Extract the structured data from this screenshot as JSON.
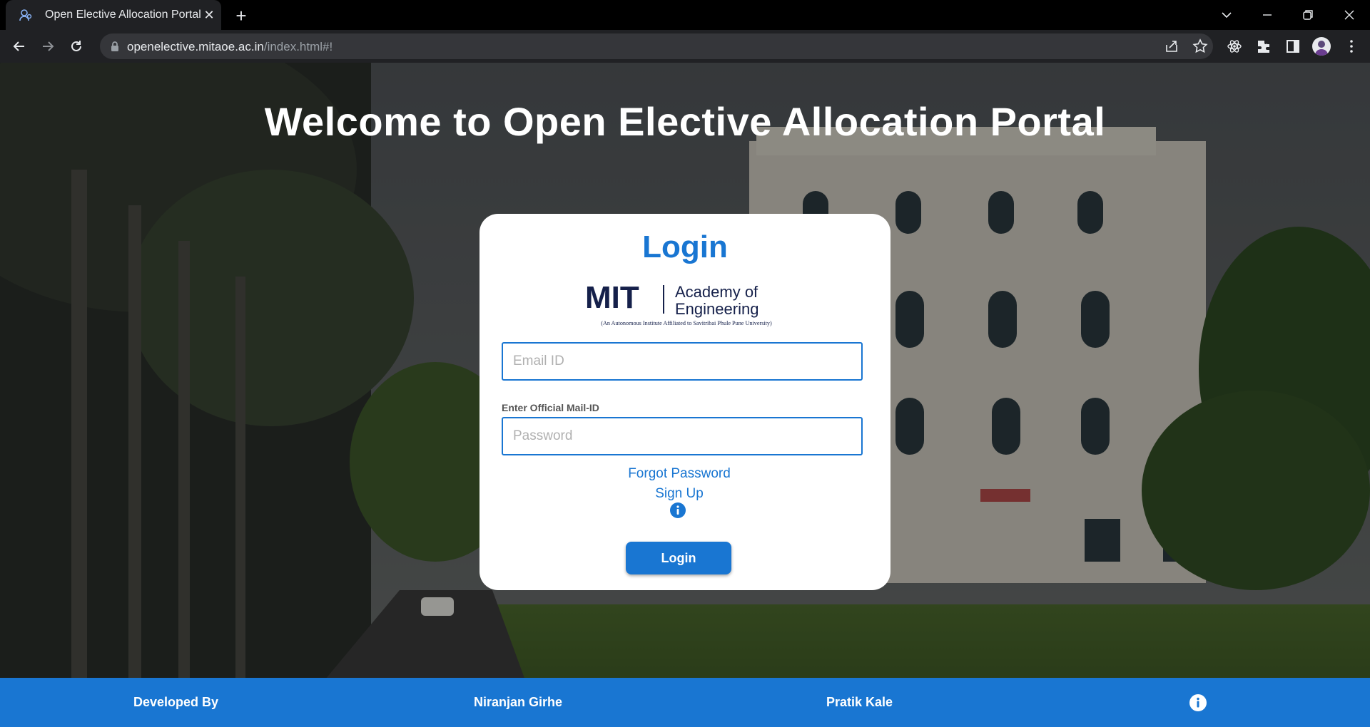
{
  "browser": {
    "tab_title": "Open Elective Allocation Portal",
    "url_host": "openelective.mitaoe.ac.in",
    "url_path": "/index.html#!"
  },
  "page": {
    "headline": "Welcome to Open Elective Allocation Portal",
    "login_card": {
      "title": "Login",
      "logo": {
        "brand": "MIT",
        "line1": "Academy of",
        "line2": "Engineering",
        "tagline": "(An Autonomous Institute Affiliated to Savitribai Phule Pune University)"
      },
      "email_placeholder": "Email ID",
      "email_hint": "Enter Official Mail-ID",
      "password_placeholder": "Password",
      "forgot_password": "Forgot Password",
      "sign_up": "Sign Up",
      "login_button": "Login"
    }
  },
  "footer": {
    "developed_by": "Developed By",
    "developer1": "Niranjan Girhe",
    "developer2": "Pratik Kale"
  },
  "colors": {
    "primary": "#1976d2",
    "chrome_dark": "#202124",
    "omnibox": "#35363a"
  },
  "icons": [
    "tab-favicon-icon",
    "close-icon",
    "plus-icon",
    "chevron-down-icon",
    "minimize-icon",
    "restore-icon",
    "window-close-icon",
    "back-icon",
    "forward-icon",
    "reload-icon",
    "lock-icon",
    "share-icon",
    "star-icon",
    "react-devtools-icon",
    "extensions-icon",
    "side-panel-icon",
    "menu-icon",
    "info-icon"
  ]
}
